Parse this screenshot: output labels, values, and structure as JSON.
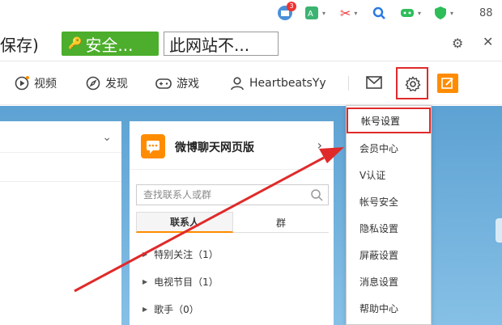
{
  "extensions": {
    "items": [
      {
        "name": "mail-ext",
        "badge": "3"
      },
      {
        "name": "translate-ext"
      },
      {
        "name": "scissors-ext"
      },
      {
        "name": "find-ext"
      },
      {
        "name": "game-ext"
      },
      {
        "name": "shield-ext"
      },
      {
        "name": "apps-ext",
        "label": "88"
      }
    ]
  },
  "address_bar": {
    "save_text": "保存)",
    "security_label": "安全...",
    "site_label": "此网站不..."
  },
  "nav": {
    "video": "视频",
    "discover": "发现",
    "games": "游戏",
    "username": "HeartbeatsYy"
  },
  "chat": {
    "title": "微博聊天网页版",
    "search_placeholder": "查找联系人或群",
    "tab_contacts": "联系人",
    "tab_groups": "群",
    "groups": [
      {
        "label": "特别关注（1）"
      },
      {
        "label": "电视节目（1）"
      },
      {
        "label": "歌手（0）"
      }
    ]
  },
  "dropdown": {
    "items": [
      {
        "label": "帐号设置",
        "highlighted": true
      },
      {
        "label": "会员中心"
      },
      {
        "label": "V认证"
      },
      {
        "label": "帐号安全"
      },
      {
        "label": "隐私设置"
      },
      {
        "label": "屏蔽设置"
      },
      {
        "label": "消息设置"
      },
      {
        "label": "帮助中心"
      }
    ]
  },
  "colors": {
    "accent_orange": "#ff8c00",
    "security_green": "#4cae2c",
    "highlight_red": "#e02a2a",
    "page_blue": "#6fb0dc"
  }
}
